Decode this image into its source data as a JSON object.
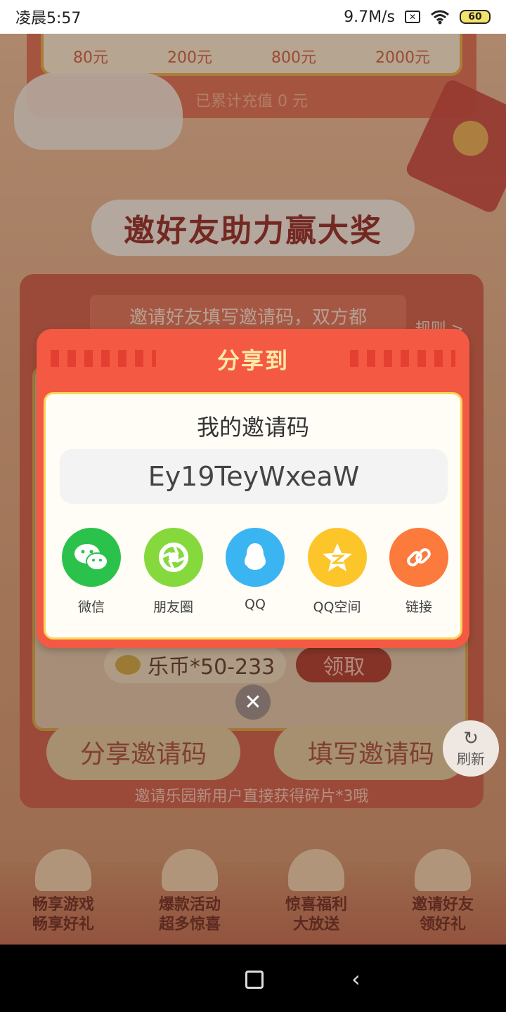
{
  "status_bar": {
    "time": "凌晨5:57",
    "speed": "9.7M/s",
    "battery": "60"
  },
  "background": {
    "reward_amounts": [
      "80元",
      "200元",
      "800元",
      "2000元"
    ],
    "accumulated_text": "已累计充值 0 元",
    "section_title": "邀好友助力赢大奖",
    "invite_banner": "邀请好友填写邀请码，双方都",
    "rules_link": "规则 >",
    "coin_text": "乐币*50-233",
    "claim_label": "领取",
    "share_code_button": "分享邀请码",
    "fill_code_button": "填写邀请码",
    "hint": "邀请乐园新用户直接获得碎片*3哦",
    "refresh_label": "刷新",
    "features": [
      {
        "line1": "畅享游戏",
        "line2": "畅享好礼"
      },
      {
        "line1": "爆款活动",
        "line2": "超多惊喜"
      },
      {
        "line1": "惊喜福利",
        "line2": "大放送"
      },
      {
        "line1": "邀请好友",
        "line2": "领好礼"
      }
    ]
  },
  "dialog": {
    "title": "分享到",
    "code_label": "我的邀请码",
    "invite_code": "Ey19TeyWxeaW",
    "share_targets": [
      {
        "label": "微信",
        "icon": "wechat-icon",
        "color": "#2bc24c"
      },
      {
        "label": "朋友圈",
        "icon": "moments-icon",
        "color": "#86d93c"
      },
      {
        "label": "QQ",
        "icon": "qq-icon",
        "color": "#3bb4f2"
      },
      {
        "label": "QQ空间",
        "icon": "qzone-icon",
        "color": "#fcc62a"
      },
      {
        "label": "链接",
        "icon": "link-icon",
        "color": "#fb7a3c"
      }
    ]
  },
  "close_symbol": "✕"
}
